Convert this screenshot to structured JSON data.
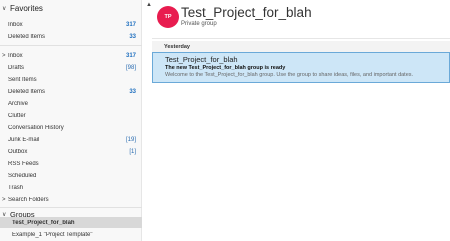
{
  "sidebar": {
    "favorites": {
      "header": "Favorites",
      "items": [
        {
          "label": "Inbox",
          "count": "317"
        },
        {
          "label": "Deleted Items",
          "count": "33"
        }
      ]
    },
    "account_folders": [
      {
        "label": "Inbox",
        "count": "317",
        "chevron": ">"
      },
      {
        "label": "Drafts",
        "count": "[98]"
      },
      {
        "label": "Sent Items",
        "count": ""
      },
      {
        "label": "Deleted Items",
        "count": "33"
      },
      {
        "label": "Archive",
        "count": ""
      },
      {
        "label": "Clutter",
        "count": ""
      },
      {
        "label": "Conversation History",
        "count": ""
      },
      {
        "label": "Junk E-mail",
        "count": "[19]"
      },
      {
        "label": "Outbox",
        "count": "[1]"
      },
      {
        "label": "RSS Feeds",
        "count": ""
      },
      {
        "label": "Scheduled",
        "count": ""
      },
      {
        "label": "Trash",
        "count": ""
      },
      {
        "label": "Search Folders",
        "count": "",
        "chevron": ">"
      }
    ],
    "groups": {
      "header": "Groups",
      "items": [
        {
          "label": "Test_Project_for_blah",
          "selected": true
        },
        {
          "label": "Example_1 \"Project Template\""
        }
      ]
    }
  },
  "group": {
    "avatar_initials": "TP",
    "avatar_color": "#e81c4f",
    "title": "Test_Project_for_blah",
    "subtitle": "Private group"
  },
  "messages": {
    "date_header": "Yesterday",
    "items": [
      {
        "sender": "Test_Project_for_blah",
        "subject": "The new Test_Project_for_blah group is ready",
        "preview": "Welcome to the Test_Project_for_blah group.  Use the group to share ideas, files, and important dates."
      }
    ]
  },
  "icons": {
    "collapse_chevron": "∨",
    "expand_chevron": ">",
    "scroll_up": "▲"
  }
}
